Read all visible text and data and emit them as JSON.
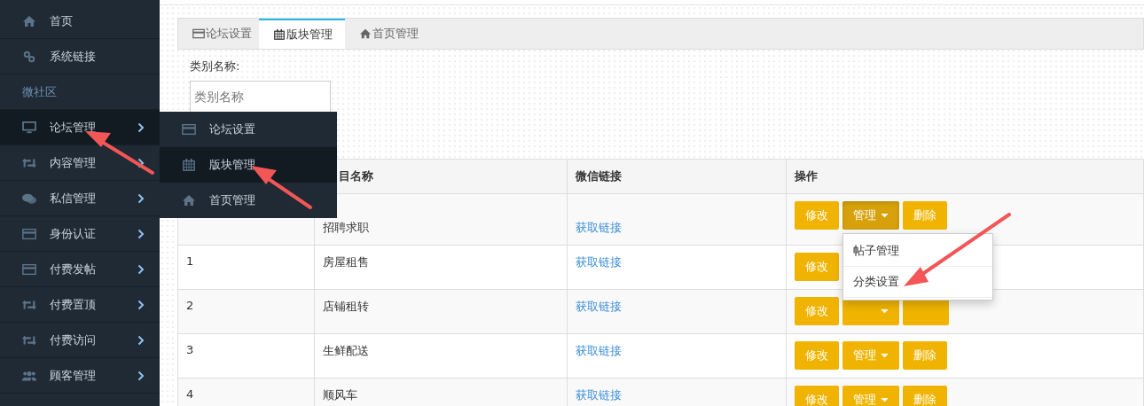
{
  "sidebar": {
    "items": [
      {
        "kind": "link",
        "label": "首页",
        "selected": false,
        "expandable": false
      },
      {
        "kind": "link",
        "label": "系统链接",
        "selected": false,
        "expandable": false
      },
      {
        "kind": "section",
        "label": "微社区"
      },
      {
        "kind": "link",
        "label": "论坛管理",
        "selected": true,
        "expandable": true
      },
      {
        "kind": "link",
        "label": "内容管理",
        "selected": false,
        "expandable": true
      },
      {
        "kind": "link",
        "label": "私信管理",
        "selected": false,
        "expandable": true
      },
      {
        "kind": "link",
        "label": "身份认证",
        "selected": false,
        "expandable": true
      },
      {
        "kind": "link",
        "label": "付费发帖",
        "selected": false,
        "expandable": true
      },
      {
        "kind": "link",
        "label": "付费置顶",
        "selected": false,
        "expandable": true
      },
      {
        "kind": "link",
        "label": "付费访问",
        "selected": false,
        "expandable": true
      },
      {
        "kind": "link",
        "label": "顾客管理",
        "selected": false,
        "expandable": true
      }
    ]
  },
  "flyout": {
    "items": [
      {
        "label": "论坛设置",
        "selected": false
      },
      {
        "label": "版块管理",
        "selected": true
      },
      {
        "label": "首页管理",
        "selected": false
      }
    ]
  },
  "tabs": [
    {
      "label": "论坛设置",
      "selected": false
    },
    {
      "label": "版块管理",
      "selected": true
    },
    {
      "label": "首页管理",
      "selected": false
    }
  ],
  "form": {
    "label": "类别名称:",
    "placeholder": "类别名称"
  },
  "table": {
    "columns": [
      "目名称",
      "微信链接",
      "操作"
    ],
    "rows": [
      {
        "name": "招聘求职",
        "link": "获取链接",
        "actions": [
          {
            "kind": "edit",
            "label": "修改"
          },
          {
            "kind": "manage",
            "label": "管理",
            "open": true
          },
          {
            "kind": "delete",
            "label": "删除"
          }
        ]
      },
      {
        "id": "1",
        "name": "房屋租售",
        "link": "获取链接",
        "actions": [
          {
            "kind": "edit",
            "label": "修改"
          }
        ]
      },
      {
        "id": "2",
        "name": "店铺租转",
        "link": "获取链接",
        "actions": [
          {
            "kind": "edit",
            "label": "修改"
          },
          {
            "kind": "manage",
            "open": false
          },
          {
            "kind": "delete"
          }
        ]
      },
      {
        "id": "3",
        "name": "生鲜配送",
        "link": "获取链接",
        "actions": [
          {
            "kind": "edit",
            "label": "修改"
          },
          {
            "kind": "manage",
            "label": "管理",
            "open": false
          },
          {
            "kind": "delete",
            "label": "删除"
          }
        ]
      },
      {
        "id": "4",
        "name": "顺风车",
        "link": "获取链接",
        "actions": [
          {
            "kind": "edit",
            "label": "修改"
          },
          {
            "kind": "manage",
            "label": "管理",
            "open": false
          },
          {
            "kind": "delete",
            "label": "删除"
          }
        ]
      }
    ]
  },
  "dropdown": {
    "items": [
      "帖子管理",
      "分类设置"
    ]
  }
}
